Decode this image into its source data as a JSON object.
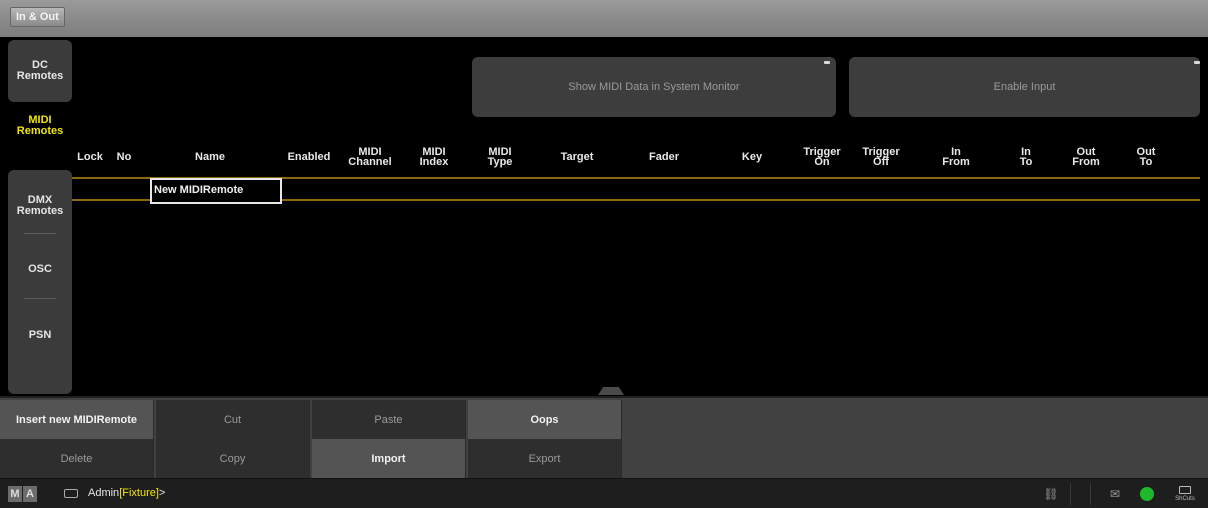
{
  "window": {
    "title": "In & Out"
  },
  "sidebar": {
    "tabs": [
      {
        "label": "DC\nRemotes",
        "state": "inactive"
      },
      {
        "label": "MIDI\nRemotes",
        "state": "active"
      },
      {
        "label": "DMX\nRemotes",
        "state": "inactive"
      },
      {
        "label": "OSC",
        "state": "inactive"
      },
      {
        "label": "PSN",
        "state": "inactive"
      }
    ]
  },
  "toolbar": {
    "show_midi_label": "Show MIDI Data in System Monitor",
    "enable_input_label": "Enable Input"
  },
  "table": {
    "columns": [
      "Lock",
      "No",
      "Name",
      "Enabled",
      "MIDI\nChannel",
      "MIDI\nIndex",
      "MIDI\nType",
      "Target",
      "Fader",
      "Key",
      "Trigger\nOn",
      "Trigger\nOff",
      "In\nFrom",
      "In\nTo",
      "Out\nFrom",
      "Out\nTo"
    ],
    "rows": [
      {
        "name": "New MIDIRemote"
      }
    ]
  },
  "bottom_bar": {
    "row1": [
      {
        "label": "Insert new MIDIRemote",
        "enabled": true
      },
      {
        "label": "Cut",
        "enabled": false
      },
      {
        "label": "Paste",
        "enabled": false
      },
      {
        "label": "Oops",
        "enabled": true
      }
    ],
    "row2": [
      {
        "label": "Delete",
        "enabled": false
      },
      {
        "label": "Copy",
        "enabled": false
      },
      {
        "label": "Import",
        "enabled": true
      },
      {
        "label": "Export",
        "enabled": false
      }
    ]
  },
  "command_line": {
    "logo": [
      "M",
      "A"
    ],
    "user": "Admin",
    "context": "[Fixture]",
    "prompt_suffix": ">"
  },
  "status_tray": {
    "shortcuts_label": "ShCuts",
    "network_color": "#1fb82c"
  },
  "colors": {
    "accent_yellow": "#f2e600",
    "row_line": "#8a6a10"
  }
}
